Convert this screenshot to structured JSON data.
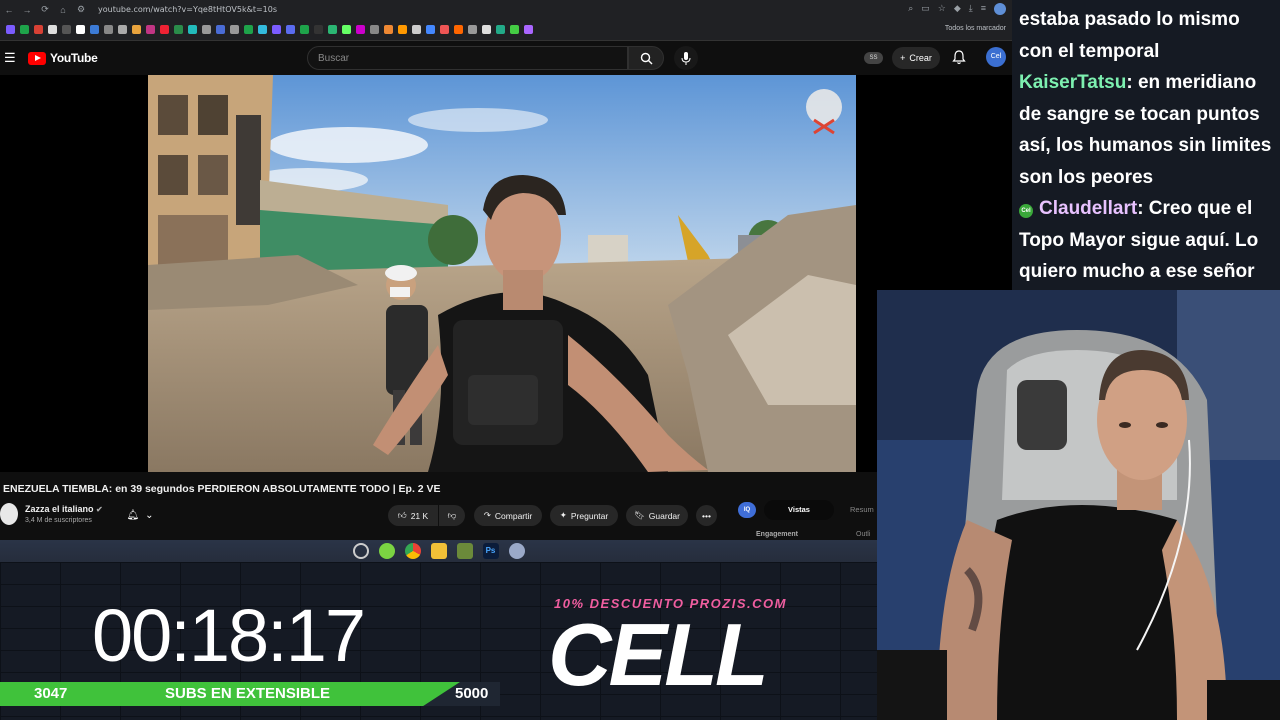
{
  "browser": {
    "url": "youtube.com/watch?v=Yqe8tHtOV5k&t=10s",
    "bookmarks_all": "Todos los marcador"
  },
  "youtube": {
    "logo_text": "YouTube",
    "search_placeholder": "Buscar",
    "ss_badge": "SS",
    "create_label": "Crear",
    "avatar_text": "Cel",
    "video_title": "ENEZUELA TIEMBLA: en 39 segundos PERDIERON ABSOLUTAMENTE TODO | Ep. 2 VE",
    "channel_name": "Zazza el italiano",
    "channel_subs": "3,4 M de suscriptores",
    "likes": "21 K",
    "share_label": "Compartir",
    "ask_label": "Preguntar",
    "save_label": "Guardar",
    "iq_chip": "IQ",
    "tab_vistas": "Vistas",
    "tab_resumen": "Resum",
    "engagement": "Engagement",
    "outlier": "Outli"
  },
  "overlay": {
    "timer": "00:18:17",
    "subs_start": "3047",
    "subs_label": "SUBS EN EXTENSIBLE",
    "subs_goal": "5000",
    "subs_progress": 0.92,
    "promo": "10% DESCUENTO PROZIS.COM",
    "sponsor": "CELL"
  },
  "chat": {
    "line1": "estaba pasado lo mismo con el temporal",
    "user1": "KaiserTatsu",
    "msg1": ": en meridiano de sangre se tocan puntos así, los humanos sin limites son los peores",
    "user2": "Claudellart",
    "msg2": ": Creo que el Topo Mayor sigue aquí. Lo quiero mucho a ese señor",
    "user2_badge": "Cel"
  },
  "colors": {
    "subs_fill": "#40c23b",
    "promo": "#f05ea0",
    "chat_user1": "#7df0b0",
    "chat_user2": "#e8c2ff",
    "yt_red": "#ff0000"
  }
}
